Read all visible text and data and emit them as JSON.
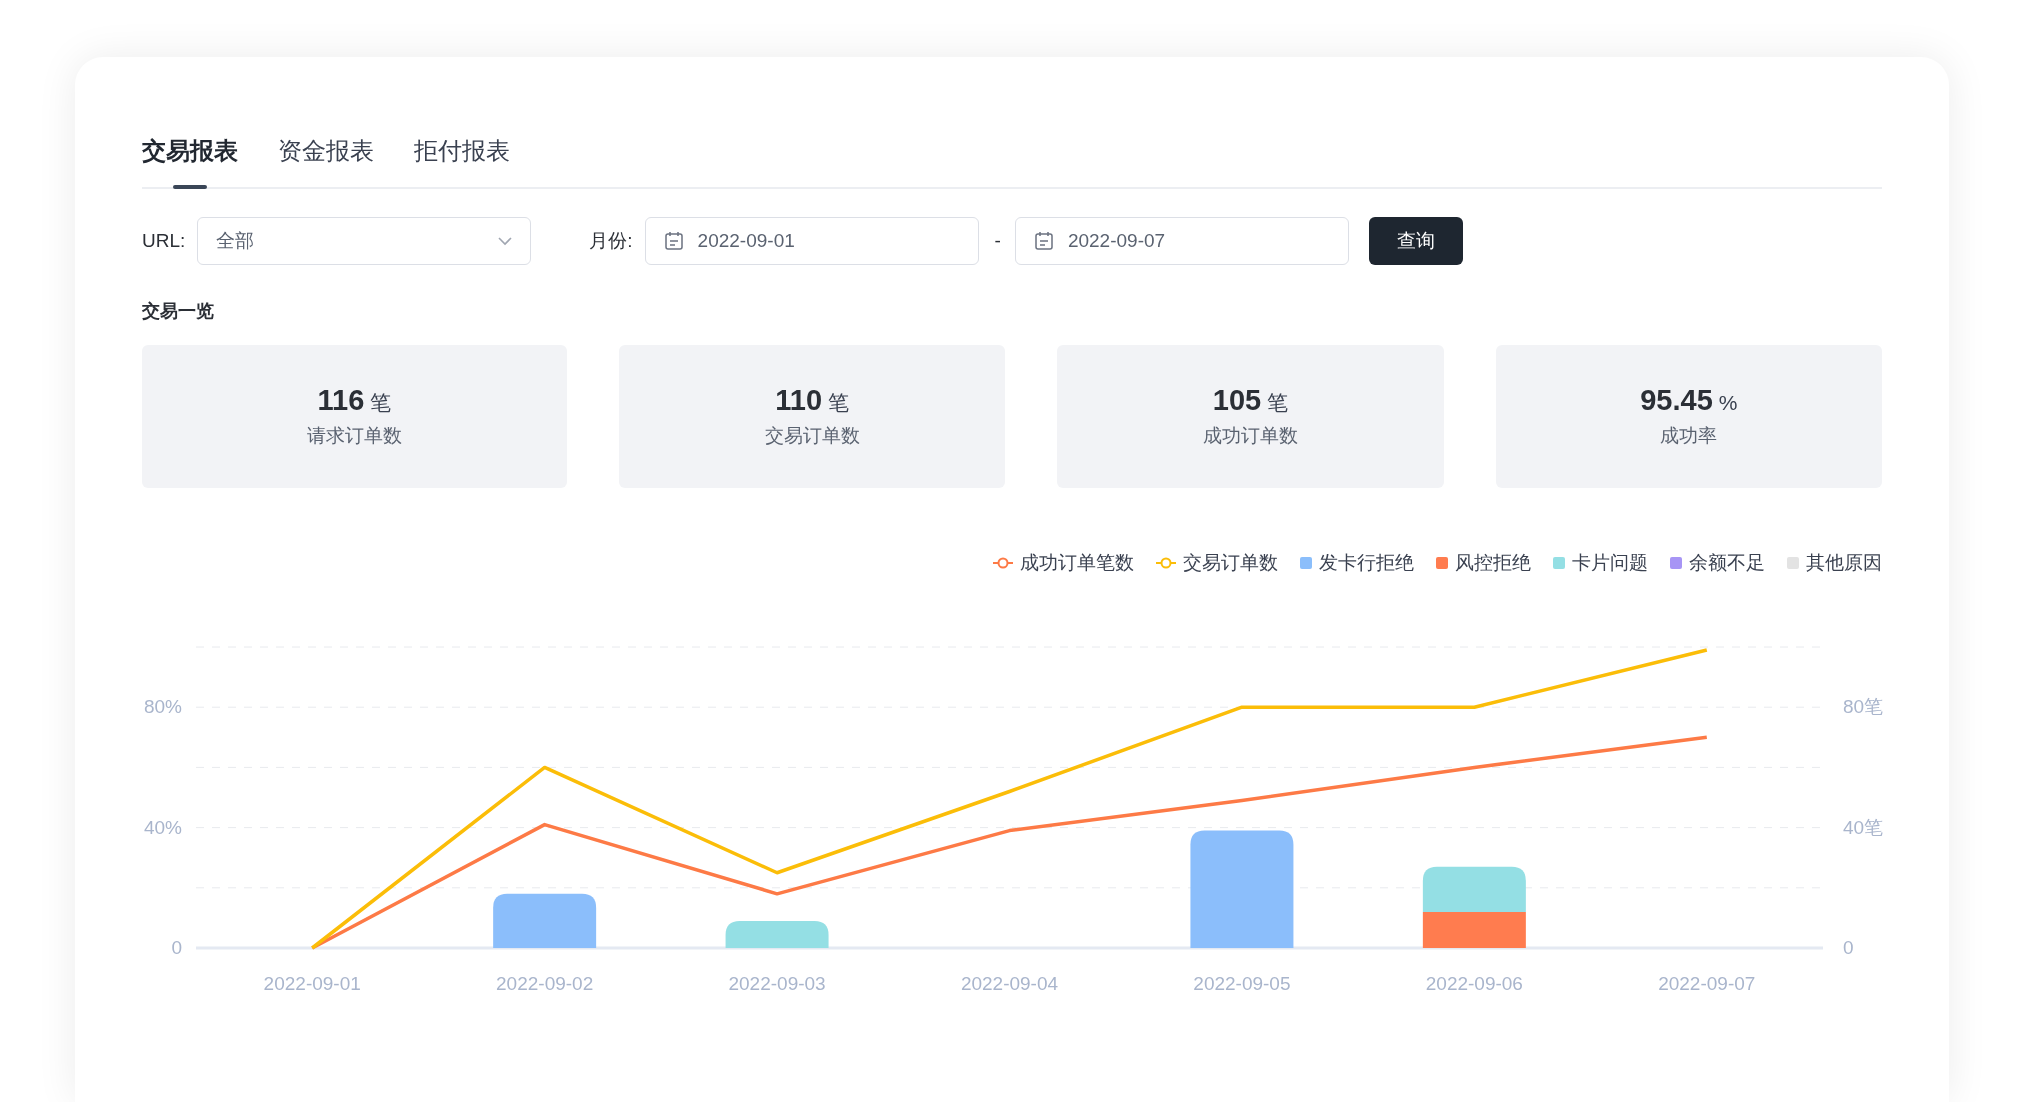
{
  "tabs": [
    {
      "label": "交易报表",
      "selected": true
    },
    {
      "label": "资金报表",
      "selected": false
    },
    {
      "label": "拒付报表",
      "selected": false
    }
  ],
  "filters": {
    "url_label": "URL:",
    "url_value": "全部",
    "month_label": "月份:",
    "start_date": "2022-09-01",
    "separator": "-",
    "end_date": "2022-09-07",
    "query_button": "查询"
  },
  "overview": {
    "title": "交易一览",
    "stats": [
      {
        "value": "116",
        "unit": "笔",
        "label": "请求订单数"
      },
      {
        "value": "110",
        "unit": "笔",
        "label": "交易订单数"
      },
      {
        "value": "105",
        "unit": "笔",
        "label": "成功订单数"
      },
      {
        "value": "95.45",
        "unit": "%",
        "label": "成功率"
      }
    ]
  },
  "chart": {
    "chart_data": {
      "type": "bar",
      "stacked": true,
      "categories": [
        "2022-09-01",
        "2022-09-02",
        "2022-09-03",
        "2022-09-04",
        "2022-09-05",
        "2022-09-06",
        "2022-09-07"
      ],
      "ylim": [
        0,
        100
      ],
      "yticks": [
        {
          "value": 0,
          "label": "0"
        },
        {
          "value": 40,
          "label": "40%"
        },
        {
          "value": 80,
          "label": "80%"
        }
      ],
      "y2lim": [
        0,
        100
      ],
      "y2ticks": [
        {
          "value": 0,
          "label": "0"
        },
        {
          "value": 40,
          "label": "40笔"
        },
        {
          "value": 80,
          "label": "80笔"
        }
      ],
      "series": [
        {
          "name": "成功订单笔数",
          "type": "line",
          "color": "#fd7a46",
          "values": [
            0,
            41,
            18,
            39,
            49,
            60,
            70
          ]
        },
        {
          "name": "交易订单数",
          "type": "line",
          "color": "#fbbd08",
          "values": [
            0,
            60,
            25,
            52,
            80,
            80,
            99
          ]
        },
        {
          "name": "发卡行拒绝",
          "color": "#8bbefb",
          "values": [
            0,
            18,
            0,
            0,
            39,
            0,
            0
          ]
        },
        {
          "name": "风控拒绝",
          "color": "#ff7c4f",
          "values": [
            0,
            0,
            0,
            0,
            0,
            12,
            0
          ]
        },
        {
          "name": "卡片问题",
          "color": "#94dfe4",
          "values": [
            0,
            0,
            9,
            0,
            0,
            15,
            0
          ]
        },
        {
          "name": "余额不足",
          "color": "#a795f5",
          "values": [
            0,
            0,
            0,
            0,
            0,
            0,
            0
          ]
        },
        {
          "name": "其他原因",
          "color": "#e3e3e3",
          "values": [
            0,
            0,
            0,
            0,
            0,
            0,
            0
          ]
        }
      ]
    }
  }
}
